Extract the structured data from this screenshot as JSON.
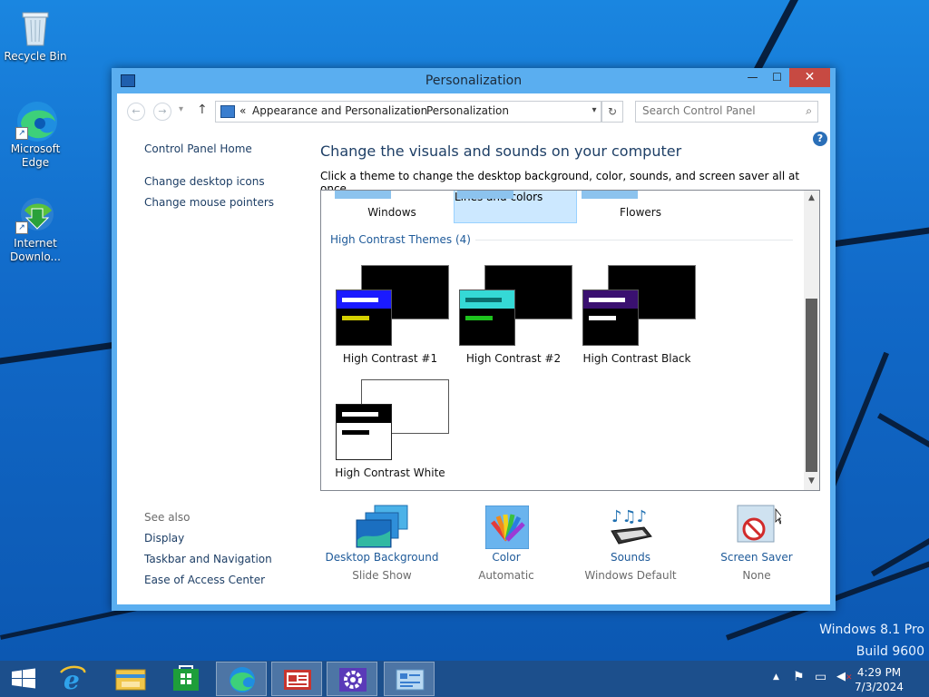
{
  "desktop": {
    "icons": [
      {
        "label": "Recycle Bin"
      },
      {
        "label": "Microsoft Edge"
      },
      {
        "label": "Internet Downlo..."
      }
    ],
    "watermark": {
      "line1": "Windows 8.1 Pro",
      "line2": "Build 9600"
    }
  },
  "window": {
    "title": "Personalization",
    "controls": {
      "minimize": "—",
      "maximize": "☐",
      "close": "✕"
    },
    "nav": {
      "back": "←",
      "forward": "→",
      "history": "▾",
      "up": "↑",
      "breadcrumb": [
        "Appearance and Personalization",
        "Personalization"
      ],
      "separator": "«",
      "chevron": "›",
      "dropdown": "▾",
      "refresh": "↻",
      "search_placeholder": "Search Control Panel",
      "search_icon": "⌕"
    },
    "left_links": {
      "home": "Control Panel Home",
      "desktop_icons": "Change desktop icons",
      "mouse_pointers": "Change mouse pointers"
    },
    "heading": "Change the visuals and sounds on your computer",
    "subheading": "Click a theme to change the desktop background, color, sounds, and screen saver all at once.",
    "help": "?",
    "themes_top": [
      "Windows",
      "Lines and colors",
      "Flowers"
    ],
    "selected_theme": "Lines and colors",
    "group_title": "High Contrast Themes (4)",
    "high_contrast": [
      {
        "label": "High Contrast #1",
        "big_bg": "#000000",
        "small_bg": "#000000",
        "title_bar": "#1a1aff",
        "line1": "#ffffff",
        "line2": "#d4d000"
      },
      {
        "label": "High Contrast #2",
        "big_bg": "#000000",
        "small_bg": "#000000",
        "title_bar": "#35d9d6",
        "line1": "#000000",
        "line2": "#1ec21e"
      },
      {
        "label": "High Contrast Black",
        "big_bg": "#000000",
        "small_bg": "#000000",
        "title_bar": "#3a1070",
        "line1": "#ffffff",
        "line2": "#ffffff"
      },
      {
        "label": "High Contrast White",
        "big_bg": "#ffffff",
        "small_bg": "#ffffff",
        "title_bar": "#000000",
        "line1": "#ffffff",
        "line2": "#000000"
      }
    ],
    "see_also": {
      "title": "See also",
      "links": [
        "Display",
        "Taskbar and Navigation",
        "Ease of Access Center"
      ]
    },
    "bottom": [
      {
        "title": "Desktop Background",
        "subtitle": "Slide Show",
        "icon": "desktop-background-icon"
      },
      {
        "title": "Color",
        "subtitle": "Automatic",
        "icon": "color-icon"
      },
      {
        "title": "Sounds",
        "subtitle": "Windows Default",
        "icon": "sounds-icon"
      },
      {
        "title": "Screen Saver",
        "subtitle": "None",
        "icon": "screen-saver-icon"
      }
    ]
  },
  "taskbar": {
    "apps": [
      "start-icon",
      "internet-explorer-icon",
      "file-explorer-icon",
      "store-icon",
      "edge-icon",
      "news-icon",
      "settings-icon",
      "control-panel-icon"
    ],
    "tray": {
      "chevron": "▲",
      "flag": "⚑",
      "network": "▭",
      "volume": "✕"
    },
    "time": "4:29 PM",
    "date": "7/3/2024"
  },
  "colors": {
    "accent": "#1e5a99",
    "window_frame": "#5aaef0",
    "close": "#c74a42",
    "taskbar": "#1c4f8c"
  }
}
